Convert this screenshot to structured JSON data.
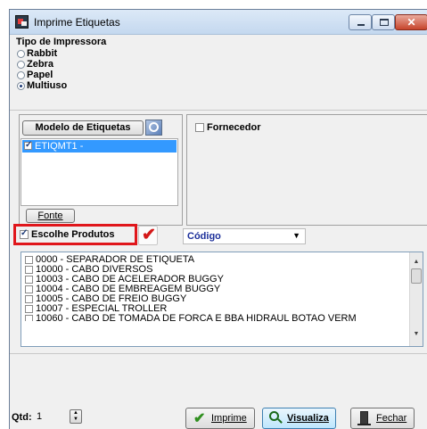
{
  "window": {
    "title": "Imprime Etiquetas",
    "minimize": "–",
    "maximize": "□",
    "close": "✕"
  },
  "printer_type": {
    "label": "Tipo de Impressora",
    "options": [
      {
        "label": "Rabbit",
        "checked": false
      },
      {
        "label": "Zebra",
        "checked": false
      },
      {
        "label": "Papel",
        "checked": false
      },
      {
        "label": "Multiuso",
        "checked": true
      }
    ]
  },
  "labels_model": {
    "button_label": "Modelo de Etiquetas",
    "icon": "label-settings-icon",
    "items": [
      {
        "label": "ETIQMT1 -",
        "checked": true,
        "selected": true
      }
    ],
    "font_button": "Fonte"
  },
  "supplier": {
    "label": "Fornecedor",
    "checked": false
  },
  "products": {
    "choose_label": "Escolhe Produtos",
    "choose_checked": true,
    "check_icon": "red-check-icon",
    "sort_select": "Código",
    "items": [
      "0000 - SEPARADOR DE ETIQUETA",
      "10000 - CABO DIVERSOS",
      "10003 - CABO DE ACELERADOR BUGGY",
      "10004 - CABO DE EMBREAGEM BUGGY",
      "10005 - CABO DE FREIO BUGGY",
      "10007 - ESPECIAL TROLLER",
      "10060 - CABO DE TOMADA DE FORCA E BBA HIDRAUL  BOTAO VERM"
    ]
  },
  "footer": {
    "qtd_label": "Qtd:",
    "qtd_value": "1",
    "print_button": "Imprime",
    "preview_button": "Visualiza",
    "close_button": "Fechar"
  },
  "colors": {
    "highlight": "#3399ff",
    "red_box": "#e0161b",
    "title_gradient_top": "#dce9f7"
  }
}
